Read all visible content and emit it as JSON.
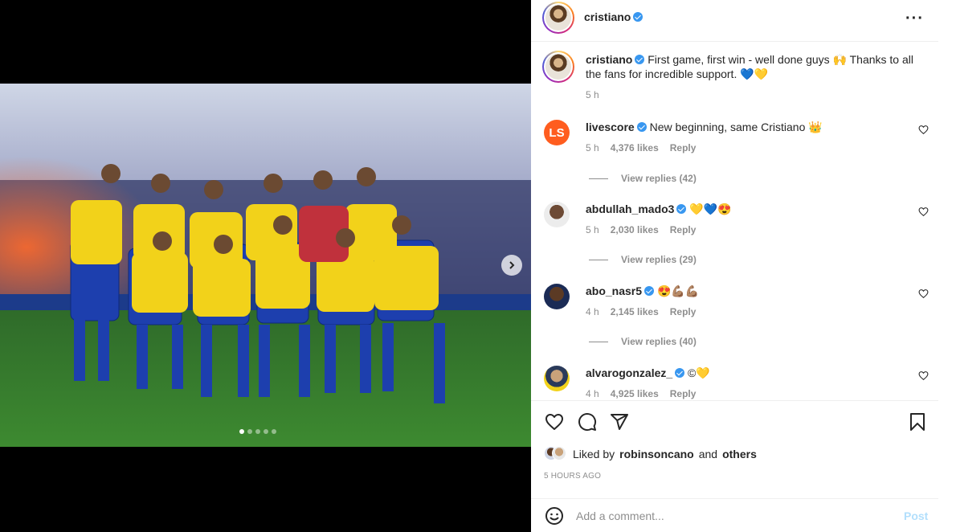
{
  "post": {
    "username": "cristiano",
    "more_icon": "more-horizontal-icon",
    "carousel": {
      "slides": 5,
      "active": 0
    }
  },
  "caption": {
    "username": "cristiano",
    "text": "First game, first win - well done guys 🙌 Thanks to all the fans for incredible support. 💙💛",
    "time": "5 h"
  },
  "comments": [
    {
      "username": "livescore",
      "verified": true,
      "text": "New beginning, same Cristiano 👑",
      "time": "5 h",
      "likes": "4,376 likes",
      "reply": "Reply",
      "view_replies": "View replies (42)"
    },
    {
      "username": "abdullah_mado3",
      "verified": true,
      "text": "💛💙😍",
      "time": "5 h",
      "likes": "2,030 likes",
      "reply": "Reply",
      "view_replies": "View replies (29)"
    },
    {
      "username": "abo_nasr5",
      "verified": true,
      "text": "😍💪🏽💪🏽",
      "time": "4 h",
      "likes": "2,145 likes",
      "reply": "Reply",
      "view_replies": "View replies (40)"
    },
    {
      "username": "alvarogonzalez_",
      "verified": true,
      "text": "©💛",
      "time": "4 h",
      "likes": "4,925 likes",
      "reply": "Reply"
    }
  ],
  "likes": {
    "prefix": "Liked by",
    "user": "robinsoncano",
    "and": "and",
    "others": "others"
  },
  "timestamp": "5 HOURS AGO",
  "composer": {
    "placeholder": "Add a comment...",
    "post_label": "Post"
  },
  "colors": {
    "verified": "#3897f0",
    "post_disabled": "#b2dffc",
    "livescore": "#ff5d1f"
  }
}
